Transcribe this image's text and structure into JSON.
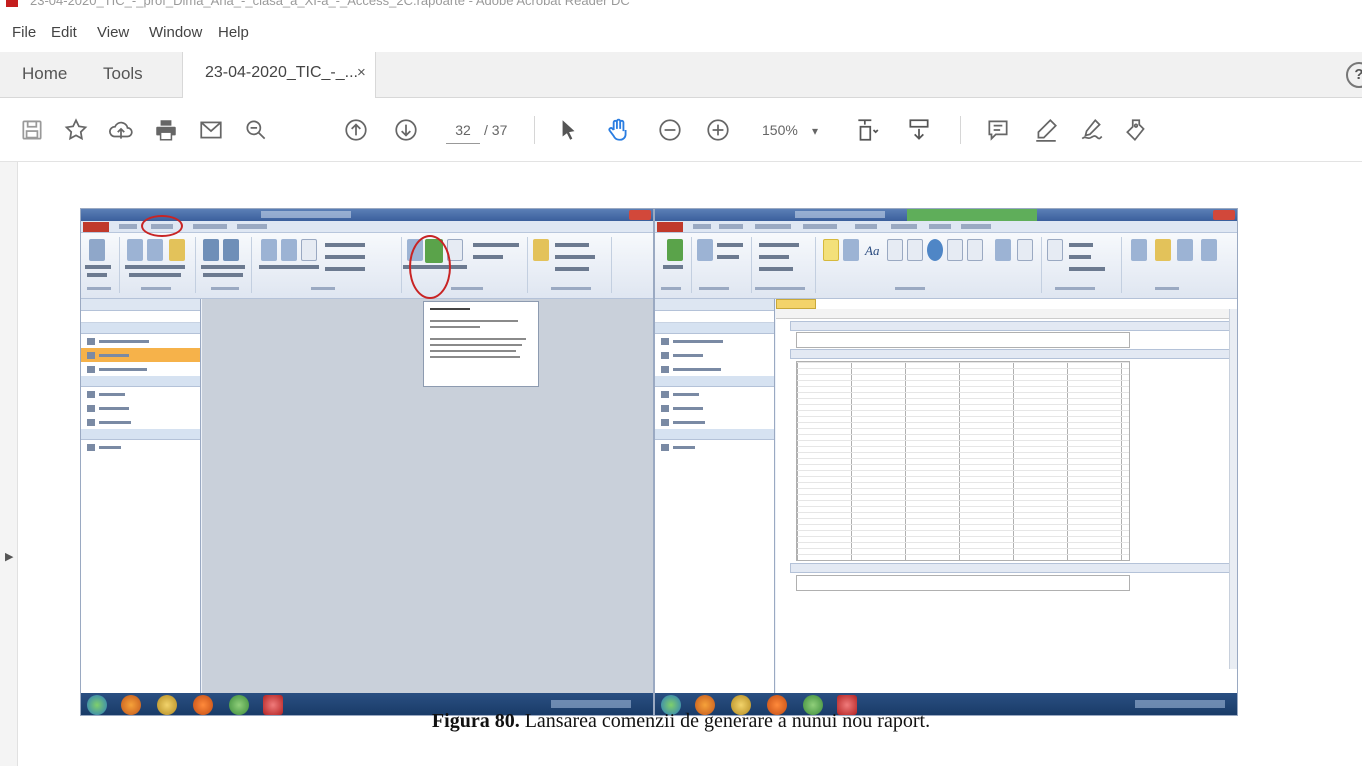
{
  "window": {
    "title": "23-04-2020_TIC_-_prof_Dima_Ana_-_clasa_a_XI-a_-_Access_2C.rapoarte - Adobe Acrobat Reader DC"
  },
  "menu": [
    "File",
    "Edit",
    "View",
    "Window",
    "Help"
  ],
  "tabs": {
    "home": "Home",
    "tools": "Tools",
    "document": "23-04-2020_TIC_-_...",
    "close_glyph": "×",
    "help_glyph": "?"
  },
  "toolbar": {
    "current_page": "32",
    "total_pages": "/ 37",
    "zoom": "150%",
    "zoom_caret": "▾",
    "icons": [
      "save-icon",
      "bookmark-star-icon",
      "upload-cloud-icon",
      "print-icon",
      "email-icon",
      "zoom-search-icon",
      "page-up-icon",
      "page-down-icon",
      "select-cursor-icon",
      "hand-tool-icon",
      "zoom-out-icon",
      "zoom-in-icon",
      "fit-page-icon",
      "scroll-mode-icon",
      "comment-icon",
      "highlight-pen-icon",
      "sign-icon",
      "share-icon"
    ]
  },
  "left_rail": {
    "expand_glyph": "▶"
  },
  "figure": {
    "caption_label": "Figura 80.",
    "caption_text": " Lansarea comenzii de generare a nunui nou raport.",
    "colors": {
      "ribbon_file_tab": "#c0392b",
      "selected_table": "#f6b24a",
      "annotation_circle": "#c82424",
      "taskbar": "#1d4272"
    }
  }
}
